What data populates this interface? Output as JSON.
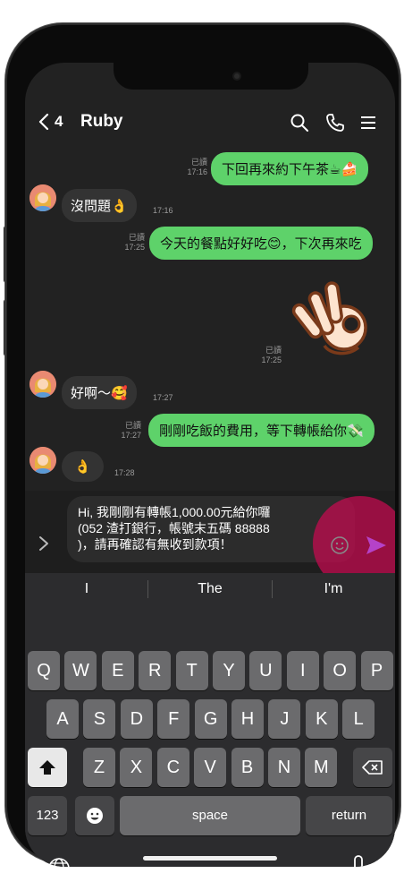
{
  "header": {
    "back_count": "4",
    "contact_name": "Ruby"
  },
  "messages": [
    {
      "id": "m1",
      "direction": "out",
      "text": "下回再來約下午茶☕🍰",
      "read": "已讀",
      "time": "17:16"
    },
    {
      "id": "m2",
      "direction": "in",
      "text": "沒問題👌",
      "time": "17:16"
    },
    {
      "id": "m3",
      "direction": "out",
      "text": "今天的餐點好好吃😊，下次再來吃",
      "read": "已讀",
      "time": "17:25"
    },
    {
      "id": "m4",
      "direction": "out",
      "sticker": "ok-hand-sticker",
      "text": "👌",
      "read": "已讀",
      "time": "17:25"
    },
    {
      "id": "m5",
      "direction": "in",
      "text": "好啊～🥰",
      "time": "17:27"
    },
    {
      "id": "m6",
      "direction": "out",
      "text": "剛剛吃飯的費用，等下轉帳給你💸",
      "read": "已讀",
      "time": "17:27"
    },
    {
      "id": "m7",
      "direction": "in",
      "text": "👌",
      "time": "17:28"
    }
  ],
  "composer": {
    "line1": "Hi, 我剛剛有轉帳1,000.00元給你囉",
    "line2": "(052 渣打銀行，帳號末五碼 88888",
    "line3": ")，請再確認有無收到款項！"
  },
  "keyboard": {
    "suggestions": [
      "I",
      "The",
      "I'm"
    ],
    "row1": [
      "Q",
      "W",
      "E",
      "R",
      "T",
      "Y",
      "U",
      "I",
      "O",
      "P"
    ],
    "row2": [
      "A",
      "S",
      "D",
      "F",
      "G",
      "H",
      "J",
      "K",
      "L"
    ],
    "row3": [
      "Z",
      "X",
      "C",
      "V",
      "B",
      "N",
      "M"
    ],
    "numbers_key": "123",
    "space_key": "space",
    "return_key": "return"
  },
  "colors": {
    "outgoing_bubble": "#5ed26a",
    "incoming_bubble": "#333333",
    "highlight": "#c80a50",
    "send": "#b542c8"
  }
}
